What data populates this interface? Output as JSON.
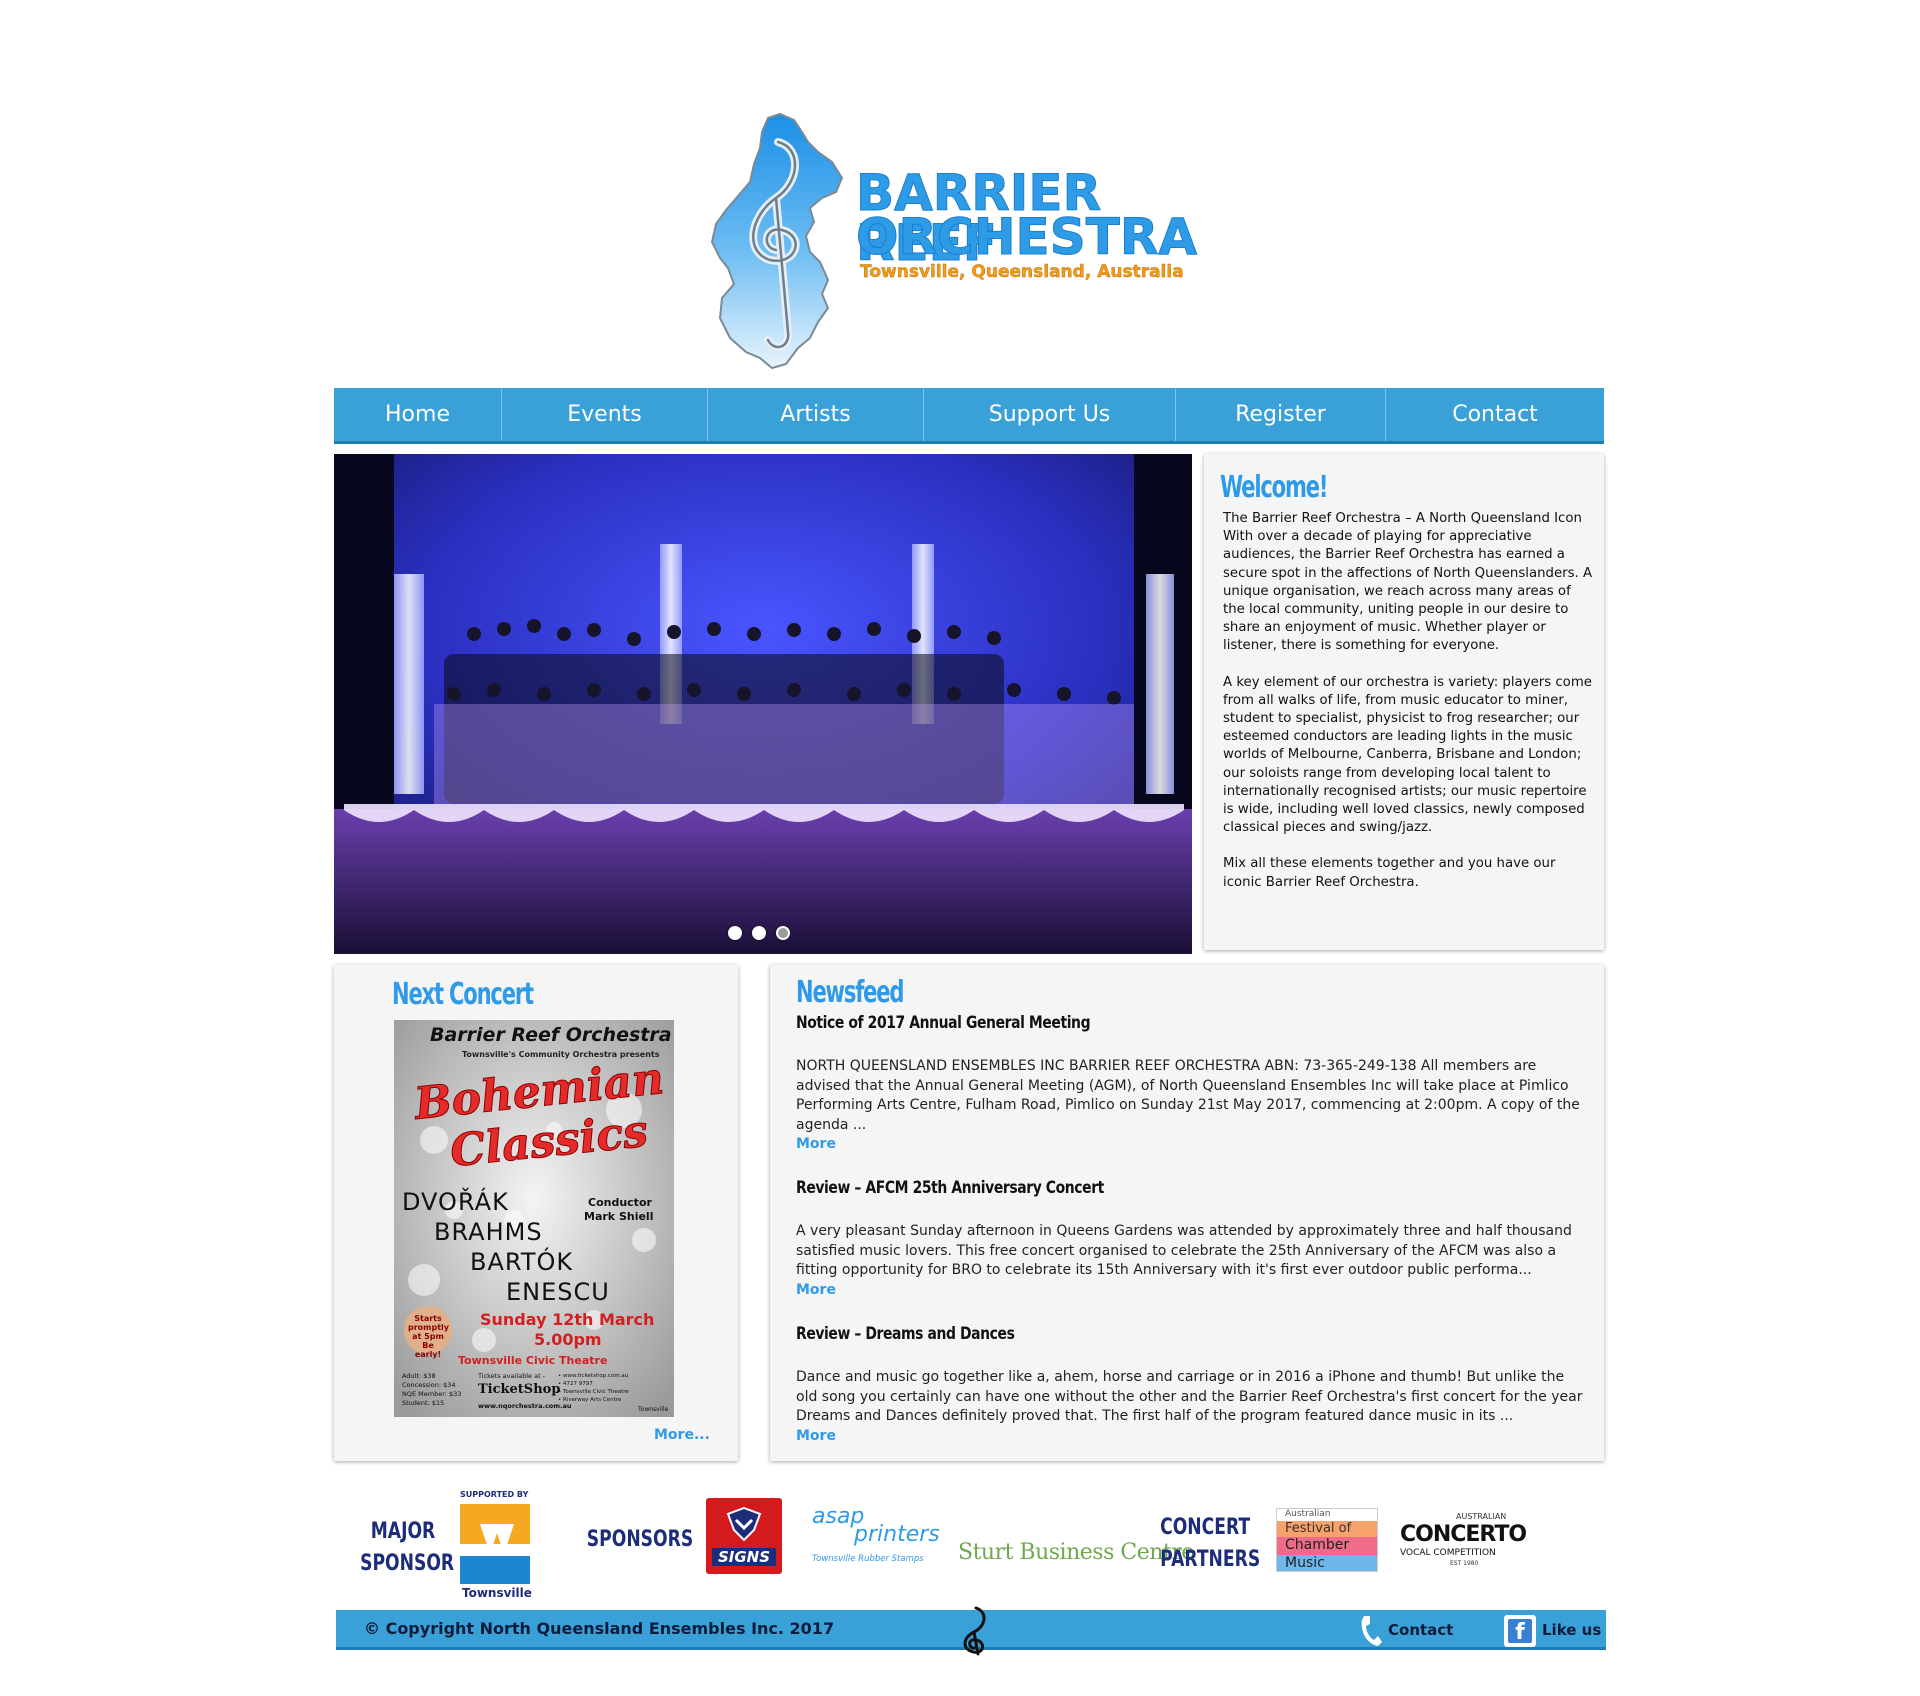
{
  "logo": {
    "line1": "BARRIER REEF",
    "line2": "ORCHESTRA",
    "tagline": "Townsville, Queensland, Australia",
    "icon": "treble-clef-icon"
  },
  "nav": {
    "items": [
      {
        "label": "Home"
      },
      {
        "label": "Events"
      },
      {
        "label": "Artists"
      },
      {
        "label": "Support Us"
      },
      {
        "label": "Register"
      },
      {
        "label": "Contact"
      }
    ]
  },
  "slideshow": {
    "slide_count": 3,
    "selected_index": 2
  },
  "welcome": {
    "heading": "Welcome!",
    "paragraphs": [
      "The Barrier Reef Orchestra – A North Queensland Icon\nWith over a decade of playing for appreciative audiences, the Barrier Reef Orchestra has earned a secure spot in the affections of North Queenslanders. A unique organisation, we reach across many areas of the local community, uniting people in our desire to share an enjoyment of music. Whether player or listener, there is something for everyone.",
      "A key element of our orchestra is variety: players come from all walks of life, from music educator to miner, student to specialist, physicist to frog researcher; our esteemed conductors are leading lights in the music worlds of Melbourne, Canberra, Brisbane and London; our soloists range from developing local talent to internationally recognised artists; our music repertoire is wide, including well loved classics, newly composed classical pieces and swing/jazz.",
      "Mix all these elements together and you have our iconic Barrier Reef Orchestra."
    ]
  },
  "next_concert": {
    "heading": "Next Concert",
    "more_label": "More...",
    "poster": {
      "header": "Barrier Reef Orchestra",
      "subheader": "Townsville's Community Orchestra presents",
      "title_line1": "Bohemian",
      "title_line2": "Classics",
      "composers": [
        "DVOŘÁK",
        "BRAHMS",
        "BARTÓK",
        "ENESCU"
      ],
      "conductor_label": "Conductor",
      "conductor_name": "Mark Shiell",
      "start_note": "Starts promptly at 5pm Be early!",
      "date": "Sunday 12th March",
      "time": "5.00pm",
      "venue": "Townsville Civic Theatre",
      "prices": [
        "Adult: $38",
        "Concession: $34",
        "NQE Member: $33",
        "Student: $15"
      ],
      "tickets": "Tickets available at -",
      "ticketshop": "TicketShop",
      "website": "www.nqorchestra.com.au",
      "venues_small": [
        "• www.ticketshop.com.au",
        "• 4727 9797",
        "• Townsville Civic Theatre",
        "• Riverway Arts Centre"
      ],
      "city": "Townsville"
    }
  },
  "newsfeed": {
    "heading": "Newsfeed",
    "items": [
      {
        "title": "Notice of 2017 Annual General Meeting",
        "body": "NORTH QUEENSLAND ENSEMBLES INC BARRIER REEF ORCHESTRA ABN:  73-365-249-138 All members are advised that the Annual General Meeting (AGM), of North Queensland Ensembles Inc will take place at Pimlico Performing Arts Centre, Fulham Road, Pimlico on Sunday 21st May 2017, commencing at 2:00pm. A copy of the agenda ...",
        "more": "More"
      },
      {
        "title": "Review – AFCM 25th Anniversary Concert",
        "body": "A very pleasant Sunday afternoon in Queens Gardens was attended by approximately three and half thousand satisfied music lovers. This free concert organised to celebrate the 25th Anniversary of the AFCM was also a fitting opportunity for BRO to celebrate its 15th Anniversary with it's first ever outdoor public performa...",
        "more": "More"
      },
      {
        "title": "Review – Dreams and Dances",
        "body": "Dance and music go together like a, ahem, horse and carriage or in 2016 a iPhone and thumb! But unlike the old song you certainly can have one without the other and the Barrier Reef Orchestra's first concert for the year Dreams and Dances definitely proved that. The first half of the program featured dance music in its ...",
        "more": "More"
      }
    ]
  },
  "sponsors": {
    "major_label_1": "MAJOR",
    "major_label_2": "SPONSOR",
    "supported_by": "SUPPORTED BY",
    "townsville": "Townsville",
    "sponsors_label": "SPONSORS",
    "signs": "SIGNS",
    "asap_1": "asap",
    "asap_2": "printers",
    "asap_3": "Townsville Rubber Stamps",
    "sturt": "Sturt Business Centre",
    "partners_1": "CONCERT",
    "partners_2": "PARTNERS",
    "afcm_1": "Australian",
    "afcm_2": "Festival of",
    "afcm_3": "Chamber",
    "afcm_4": "Music",
    "acvc_1": "AUSTRALIAN",
    "acvc_2": "CONCERTO",
    "acvc_3": "VOCAL COMPETITION",
    "acvc_4": "EST 1980"
  },
  "footer": {
    "copyright": "© Copyright North Queensland Ensembles Inc. 2017",
    "contact": "Contact",
    "like": "Like us"
  },
  "colors": {
    "accent": "#2f9be8",
    "nav": "#3aa0d8",
    "sponsor_text": "#1d2d79",
    "tagline": "#f39a1b"
  }
}
